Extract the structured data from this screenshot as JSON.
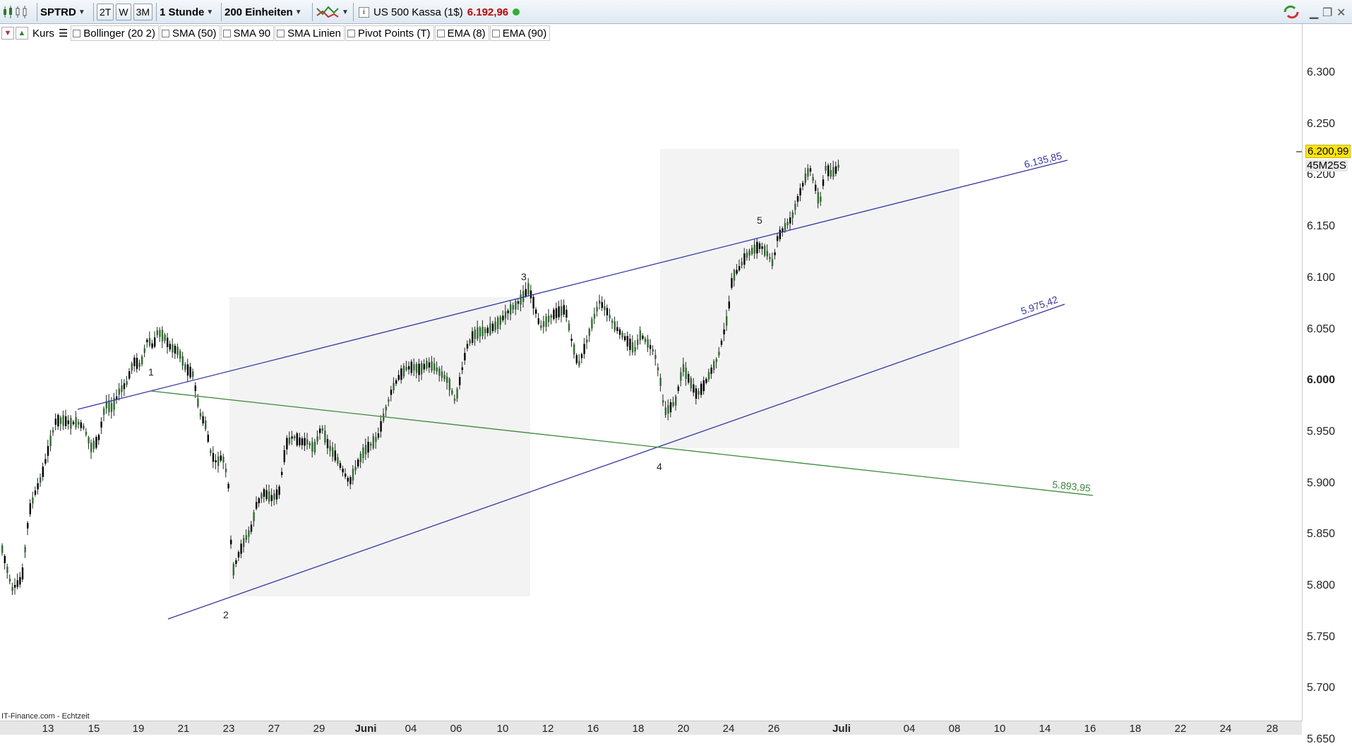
{
  "toolbar": {
    "symbol": "SPTRD",
    "range_buttons": [
      "2T",
      "W",
      "3M"
    ],
    "interval": "1 Stunde",
    "units": "200 Einheiten",
    "instrument": "US 500 Kassa (1$)",
    "price": "6.192,96",
    "price_color": "#c00000",
    "status_color": "#2ab32a"
  },
  "indicators": [
    "Bollinger (20 2)",
    "SMA (50)",
    "SMA 90",
    "SMA Linien",
    "Pivot Points (T)",
    "EMA (8)",
    "EMA (90)"
  ],
  "price_series_label": "Kurs",
  "watermark": "IT-Finance.com - Echtzeit",
  "price_axis": {
    "ticks": [
      "6.300",
      "6.250",
      "6.200",
      "6.150",
      "6.100",
      "6.050",
      "6.000",
      "5.950",
      "5.900",
      "5.850",
      "5.800",
      "5.750",
      "5.700",
      "5.650"
    ],
    "current_price": "6.200,99",
    "contract_tag": "45M25S"
  },
  "time_axis": {
    "labels": [
      "13",
      "15",
      "19",
      "21",
      "23",
      "27",
      "29",
      "Juni",
      "04",
      "06",
      "10",
      "12",
      "16",
      "18",
      "20",
      "24",
      "26",
      "Juli",
      "04",
      "08",
      "10",
      "14",
      "16",
      "18",
      "22",
      "24",
      "28"
    ]
  },
  "wave_labels": [
    "1",
    "2",
    "3",
    "4",
    "5"
  ],
  "line_labels": {
    "upper": "6.135,85",
    "lower": "5.975,42",
    "green": "5.893,95"
  },
  "colors": {
    "trend_line": "#3535a8",
    "green_line": "#3a8a3a",
    "candle_up": "#2e6e2e",
    "box_fill": "#f3f3f3"
  }
}
